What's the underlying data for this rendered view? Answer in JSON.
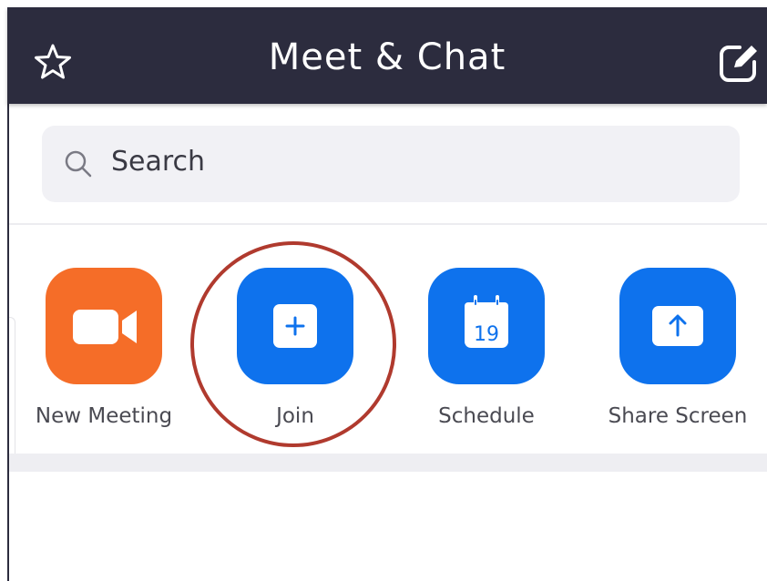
{
  "header": {
    "title": "Meet & Chat",
    "left_icon": "star-icon",
    "right_icon": "edit-icon"
  },
  "search": {
    "placeholder": "Search",
    "icon": "search-icon"
  },
  "actions": [
    {
      "label": "New Meeting",
      "icon": "video-camera-icon",
      "color": "#f56d28"
    },
    {
      "label": "Join",
      "icon": "plus-icon",
      "color": "#0e72ed"
    },
    {
      "label": "Schedule",
      "icon": "calendar-icon",
      "color": "#0e72ed",
      "calendar_day": "19"
    },
    {
      "label": "Share Screen",
      "icon": "share-upload-icon",
      "color": "#0e72ed"
    }
  ],
  "colors": {
    "header_bg": "#2c2c3e",
    "accent_blue": "#0e72ed",
    "accent_orange": "#f56d28",
    "highlight_ring": "#b03a2e"
  }
}
